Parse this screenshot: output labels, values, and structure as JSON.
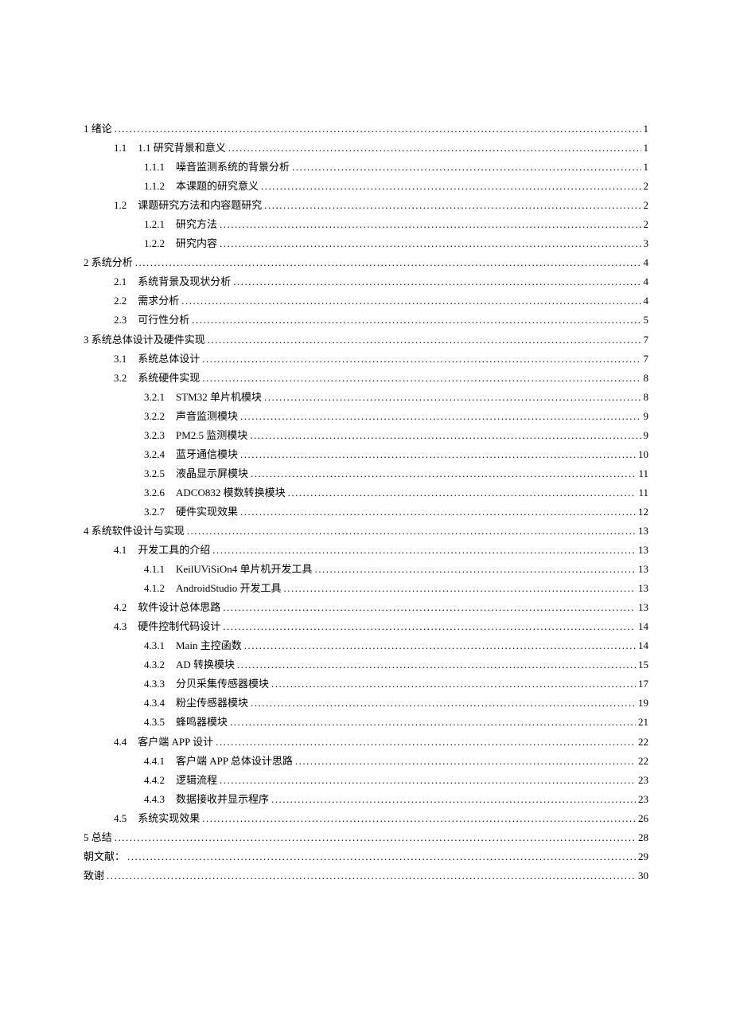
{
  "toc": [
    {
      "level": 0,
      "num": "1",
      "title": "绪论",
      "page": "1",
      "gap": ""
    },
    {
      "level": 1,
      "num": "1.1",
      "title": "1.1 研究背景和意义",
      "page": "1"
    },
    {
      "level": 2,
      "num": "1.1.1",
      "title": "噪音监测系统的背景分析",
      "page": "1"
    },
    {
      "level": 2,
      "num": "1.1.2",
      "title": "本课题的研究意义",
      "page": "2"
    },
    {
      "level": 1,
      "num": "1.2",
      "title": "课题研究方法和内容题研究",
      "page": "2"
    },
    {
      "level": 2,
      "num": "1.2.1",
      "title": "研究方法",
      "page": "2"
    },
    {
      "level": 2,
      "num": "1.2.2",
      "title": "研究内容",
      "page": "3"
    },
    {
      "level": 0,
      "num": "2",
      "title": "系统分析",
      "page": "4",
      "gap": ""
    },
    {
      "level": 1,
      "num": "2.1",
      "title": "系统背景及现状分析",
      "page": "4"
    },
    {
      "level": 1,
      "num": "2.2",
      "title": "需求分析",
      "page": "4"
    },
    {
      "level": 1,
      "num": "2.3",
      "title": "可行性分析",
      "page": "5"
    },
    {
      "level": 0,
      "num": "3",
      "title": "系统总体设计及硬件实现",
      "page": "7",
      "gap": ""
    },
    {
      "level": 1,
      "num": "3.1",
      "title": "系统总体设计",
      "page": "7"
    },
    {
      "level": 1,
      "num": "3.2",
      "title": "系统硬件实现",
      "page": "8"
    },
    {
      "level": 2,
      "num": "3.2.1",
      "title": "STM32 单片机模块",
      "page": "8"
    },
    {
      "level": 2,
      "num": "3.2.2",
      "title": "声音监测模块",
      "page": "9"
    },
    {
      "level": 2,
      "num": "3.2.3",
      "title": "PM2.5 监测模块",
      "page": "9"
    },
    {
      "level": 2,
      "num": "3.2.4",
      "title": "蓝牙通信模块",
      "page": "10"
    },
    {
      "level": 2,
      "num": "3.2.5",
      "title": "液晶显示屏模块",
      "page": "11"
    },
    {
      "level": 2,
      "num": "3.2.6",
      "title": "ADCO832 模数转换模块",
      "page": "11"
    },
    {
      "level": 2,
      "num": "3.2.7",
      "title": "硬件实现效果",
      "page": "12"
    },
    {
      "level": 0,
      "num": "4",
      "title": "系统软件设计与实现",
      "page": "13",
      "gap": ""
    },
    {
      "level": 1,
      "num": "4.1",
      "title": "开发工具的介绍",
      "page": "13"
    },
    {
      "level": 2,
      "num": "4.1.1",
      "title": "KeilUViSiOn4 单片机开发工具",
      "page": "13"
    },
    {
      "level": 2,
      "num": "4.1.2",
      "title": "AndroidStudio 开发工具",
      "page": "13"
    },
    {
      "level": 1,
      "num": "4.2",
      "title": "软件设计总体思路",
      "page": "13"
    },
    {
      "level": 1,
      "num": "4.3",
      "title": "硬件控制代码设计",
      "page": "14"
    },
    {
      "level": 2,
      "num": "4.3.1",
      "title": "Main 主控函数",
      "page": "14"
    },
    {
      "level": 2,
      "num": "4.3.2",
      "title": "AD 转换模块",
      "page": "15"
    },
    {
      "level": 2,
      "num": "4.3.3",
      "title": "分贝采集传感器模块",
      "page": "17"
    },
    {
      "level": 2,
      "num": "4.3.4",
      "title": "粉尘传感器模块",
      "page": "19"
    },
    {
      "level": 2,
      "num": "4.3.5",
      "title": "蜂鸣器模块",
      "page": "21"
    },
    {
      "level": 1,
      "num": "4.4",
      "title": "客户端 APP 设计",
      "page": "22"
    },
    {
      "level": 2,
      "num": "4.4.1",
      "title": "客户端 APP 总体设计思路",
      "page": "22"
    },
    {
      "level": 2,
      "num": "4.4.2",
      "title": "逻辑流程",
      "page": "23"
    },
    {
      "level": 2,
      "num": "4.4.3",
      "title": "数据接收并显示程序",
      "page": "23"
    },
    {
      "level": 1,
      "num": "4.5",
      "title": "系统实现效果",
      "page": "26"
    },
    {
      "level": 0,
      "num": "5",
      "title": "总结",
      "page": "28",
      "gap": ""
    },
    {
      "level": 0,
      "num": "",
      "title": "朝文献：",
      "page": "29",
      "gap": ""
    },
    {
      "level": 0,
      "num": "",
      "title": "致谢",
      "page": "30",
      "gap": ""
    }
  ]
}
